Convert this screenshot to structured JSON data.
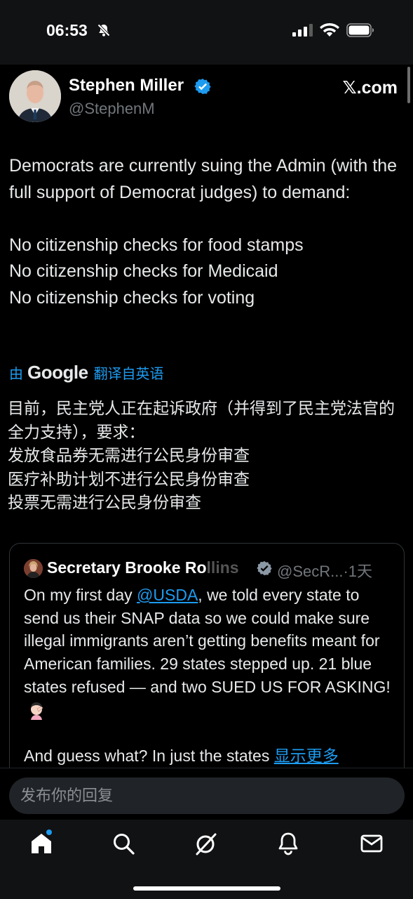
{
  "status_bar": {
    "time": "06:53"
  },
  "post": {
    "author_name": "Stephen Miller",
    "author_handle": "@StephenM",
    "source_site": "𝕏.com",
    "text": "Democrats are currently suing the Admin (with the full support of Democrat judges) to demand:\n\nNo citizenship checks for food stamps\nNo citizenship checks for Medicaid\nNo citizenship checks for voting",
    "translation": {
      "by_label": "由",
      "provider": "Google",
      "from_label": "翻译自英语",
      "text": "目前，民主党人正在起诉政府（并得到了民主党法官的全力支持），要求：\n发放食品券无需进行公民身份审查\n医疗补助计划不进行公民身份审查\n投票无需进行公民身份审查"
    }
  },
  "quote": {
    "author_name": "Secretary Brooke Ro",
    "author_name_faded": "llins",
    "author_handle": "@SecR...",
    "time": "·1天",
    "text_before_mention": "On my first day ",
    "mention": "@USDA",
    "text_after_mention": ", we told every state to send us their SNAP data so we could make sure illegal immigrants aren’t getting benefits meant for American families. 29 states stepped up. 21 blue states refused — and two SUED US FOR ASKING!",
    "text_continued": "\n\nAnd guess what? In just the states ",
    "show_more": "显示更多"
  },
  "reply": {
    "placeholder": "发布你的回复"
  },
  "colors": {
    "accent": "#1d9bf0",
    "background": "#000000",
    "text": "#e7e9ea",
    "muted": "#71767b"
  },
  "icons": {
    "tabs": [
      "home-icon",
      "search-icon",
      "grok-icon",
      "notifications-icon",
      "messages-icon"
    ]
  }
}
